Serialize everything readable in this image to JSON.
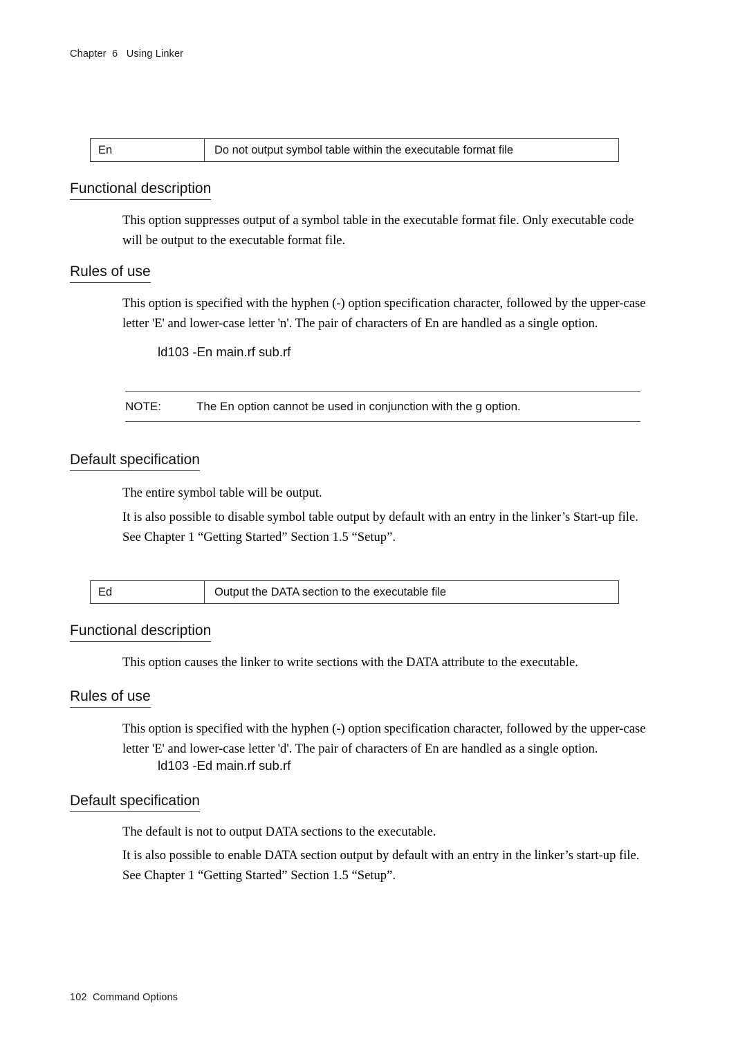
{
  "page": {
    "running_head": "Chapter  6   Using Linker",
    "running_foot": "102  Command Options"
  },
  "sections": [
    {
      "option_box": {
        "name": "En",
        "description": "Do not output symbol table within the executable format file"
      },
      "functional_description": {
        "heading": "Functional description",
        "lines": [
          "This option suppresses output of a symbol table in the executable format file. Only executable code",
          "will be output to the executable format file."
        ]
      },
      "rules_of_use": {
        "heading": "Rules of use",
        "lines": [
          "This option is specified with the hyphen (-) option specification character, followed by the upper-case",
          "letter 'E' and lower-case letter 'n'. The pair of characters of En are handled as a single option."
        ],
        "command": "ld103 -En main.rf sub.rf"
      },
      "note": {
        "label": "NOTE:",
        "text": "The En option cannot be used in conjunction with the g option."
      },
      "default_specification": {
        "heading": "Default specification",
        "paragraph1": [
          "The entire symbol table will be output."
        ],
        "paragraph2": [
          "It is also possible to disable symbol table output by default with an entry in the linker’s Start-up file.",
          "See Chapter 1 “Getting Started” Section 1.5 “Setup”."
        ]
      }
    },
    {
      "option_box": {
        "name": "Ed",
        "description": "Output the DATA section to the executable file"
      },
      "functional_description": {
        "heading": "Functional description",
        "lines": [
          "This option causes the linker to write sections with the DATA attribute to the executable."
        ]
      },
      "rules_of_use": {
        "heading": "Rules of use",
        "lines": [
          "This option is specified with the hyphen (-) option specification character, followed by the upper-case",
          "letter 'E' and lower-case letter 'd'. The pair of characters of En are handled as a single option."
        ],
        "command": "ld103 -Ed main.rf sub.rf"
      },
      "default_specification": {
        "heading": "Default specification",
        "paragraph1": [
          "The default is not to output DATA sections to the executable."
        ],
        "paragraph2": [
          "It is also possible to enable DATA section output by default with an entry in the linker’s start-up file.",
          "See Chapter 1 “Getting Started” Section 1.5 “Setup”."
        ]
      }
    }
  ]
}
